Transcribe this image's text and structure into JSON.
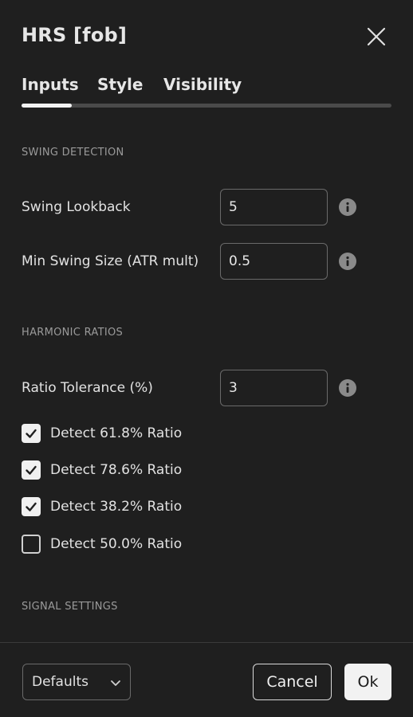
{
  "dialog": {
    "title": "HRS [fob]"
  },
  "tabs": [
    {
      "label": "Inputs",
      "active": true
    },
    {
      "label": "Style",
      "active": false
    },
    {
      "label": "Visibility",
      "active": false
    }
  ],
  "sections": {
    "swing_detection": "SWING DETECTION",
    "harmonic_ratios": "HARMONIC RATIOS",
    "signal_settings": "SIGNAL SETTINGS"
  },
  "fields": {
    "swing_lookback": {
      "label": "Swing Lookback",
      "value": "5"
    },
    "min_swing_size": {
      "label": "Min Swing Size (ATR mult)",
      "value": "0.5"
    },
    "ratio_tolerance": {
      "label": "Ratio Tolerance (%)",
      "value": "3"
    }
  },
  "checkboxes": [
    {
      "label": "Detect 61.8% Ratio",
      "checked": true
    },
    {
      "label": "Detect 78.6% Ratio",
      "checked": true
    },
    {
      "label": "Detect 38.2% Ratio",
      "checked": true
    },
    {
      "label": "Detect 50.0% Ratio",
      "checked": false
    }
  ],
  "footer": {
    "defaults_label": "Defaults",
    "cancel_label": "Cancel",
    "ok_label": "Ok"
  },
  "icons": {
    "close": "close-icon",
    "info": "info-icon",
    "check": "checkmark-icon",
    "chevron": "chevron-down-icon"
  },
  "colors": {
    "background": "#1f1f1f",
    "text": "#e2e2e2",
    "section_text": "#9a9a9a",
    "accent": "#f2f2f2"
  }
}
